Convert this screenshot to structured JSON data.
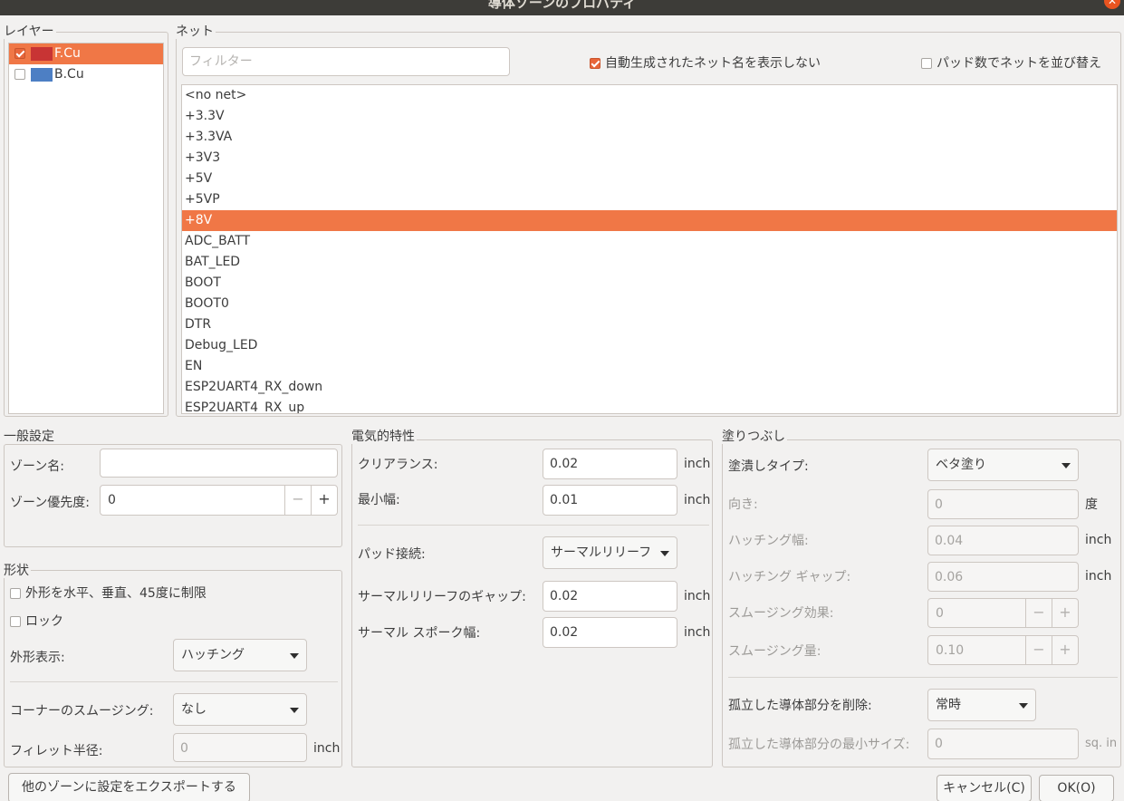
{
  "window": {
    "title": "導体ゾーンのプロパティ"
  },
  "colors": {
    "selection": "#f07746",
    "fcu": "#c83434",
    "bcu": "#4d7fc4"
  },
  "layers": {
    "label": "レイヤー",
    "items": [
      {
        "name": "F.Cu",
        "checked": true,
        "selected": true
      },
      {
        "name": "B.Cu",
        "checked": false,
        "selected": false
      }
    ]
  },
  "net": {
    "label": "ネット",
    "filter_placeholder": "フィルター",
    "hide_auto_label": "自動生成されたネット名を表示しない",
    "sort_by_pads_label": "パッド数でネットを並び替え",
    "items": [
      "<no net>",
      "+3.3V",
      "+3.3VA",
      "+3V3",
      "+5V",
      "+5VP",
      "+8V",
      "ADC_BATT",
      "BAT_LED",
      "BOOT",
      "BOOT0",
      "DTR",
      "Debug_LED",
      "EN",
      "ESP2UART4_RX_down",
      "ESP2UART4_RX_up"
    ],
    "selected": "+8V"
  },
  "general": {
    "label": "一般設定",
    "zone_name_label": "ゾーン名:",
    "zone_name_value": "",
    "priority_label": "ゾーン優先度:",
    "priority_value": "0",
    "minus": "−",
    "plus": "+"
  },
  "shape": {
    "label": "形状",
    "constrain_label": "外形を水平、垂直、45度に制限",
    "lock_label": "ロック",
    "outline_label": "外形表示:",
    "outline_value": "ハッチング",
    "corner_label": "コーナーのスムージング:",
    "corner_value": "なし",
    "fillet_label": "フィレット半径:",
    "fillet_value": "0",
    "fillet_unit": "inch"
  },
  "electrical": {
    "label": "電気的特性",
    "clearance_label": "クリアランス:",
    "clearance_value": "0.02",
    "clearance_unit": "inch",
    "min_width_label": "最小幅:",
    "min_width_value": "0.01",
    "min_width_unit": "inch",
    "pad_conn_label": "パッド接続:",
    "pad_conn_value": "サーマルリリーフ",
    "thermal_gap_label": "サーマルリリーフのギャップ:",
    "thermal_gap_value": "0.02",
    "thermal_gap_unit": "inch",
    "spoke_label": "サーマル スポーク幅:",
    "spoke_value": "0.02",
    "spoke_unit": "inch"
  },
  "fill": {
    "label": "塗りつぶし",
    "type_label": "塗潰しタイプ:",
    "type_value": "ベタ塗り",
    "orient_label": "向き:",
    "orient_value": "0",
    "orient_unit": "度",
    "hatch_width_label": "ハッチング幅:",
    "hatch_width_value": "0.04",
    "hatch_width_unit": "inch",
    "hatch_gap_label": "ハッチング ギャップ:",
    "hatch_gap_value": "0.06",
    "hatch_gap_unit": "inch",
    "smooth_effect_label": "スムージング効果:",
    "smooth_effect_value": "0",
    "smooth_amount_label": "スムージング量:",
    "smooth_amount_value": "0.10",
    "remove_islands_label": "孤立した導体部分を削除:",
    "remove_islands_value": "常時",
    "min_island_label": "孤立した導体部分の最小サイズ:",
    "min_island_value": "0",
    "min_island_unit": "sq. in"
  },
  "buttons": {
    "export": "他のゾーンに設定をエクスポートする",
    "cancel": "キャンセル(C)",
    "ok": "OK(O)"
  }
}
